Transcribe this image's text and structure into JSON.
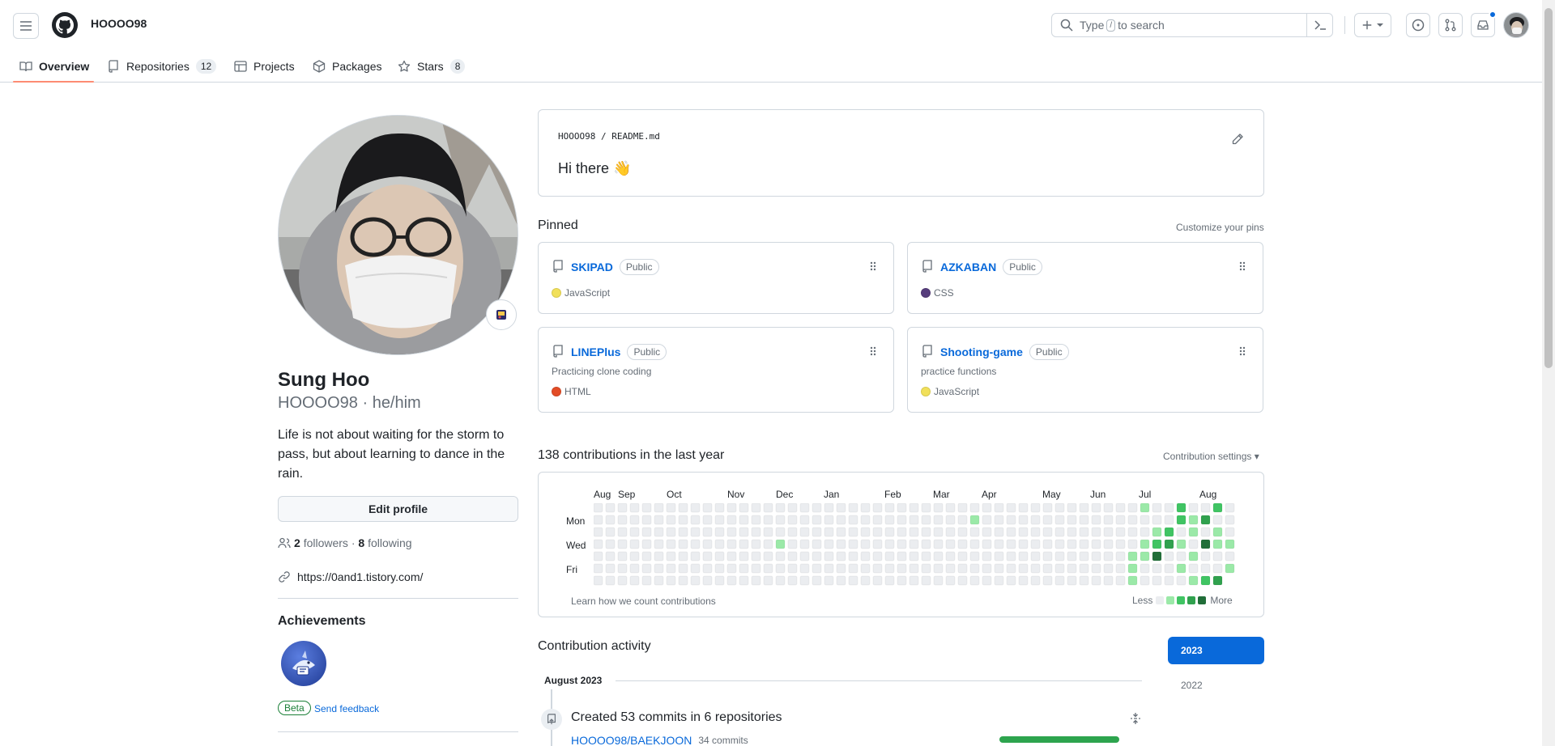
{
  "header": {
    "username": "HOOOO98",
    "search": {
      "prefix": "Type",
      "slash": "/",
      "suffix": "to search"
    },
    "has_notification": true
  },
  "tabs": [
    {
      "label": "Overview",
      "count": ""
    },
    {
      "label": "Repositories",
      "count": "12"
    },
    {
      "label": "Projects",
      "count": ""
    },
    {
      "label": "Packages",
      "count": ""
    },
    {
      "label": "Stars",
      "count": "8"
    }
  ],
  "profile": {
    "full_name": "Sung Hoo",
    "login_pronouns": "HOOOO98 · he/him",
    "bio": "Life is not about waiting for the storm to pass, but about learning to dance in the rain.",
    "edit_label": "Edit profile",
    "followers_count": "2",
    "followers_label": "followers",
    "sep": "·",
    "following_count": "8",
    "following_label": "following",
    "website": "https://0and1.tistory.com/",
    "achievements_title": "Achievements",
    "beta_label": "Beta",
    "feedback_label": "Send feedback"
  },
  "readme": {
    "path": "HOOOO98 / README.md",
    "heading": "Hi there 👋"
  },
  "pinned": {
    "title": "Pinned",
    "customize": "Customize your pins",
    "items": [
      {
        "name": "SKIPAD",
        "visibility": "Public",
        "description": "",
        "language": "JavaScript",
        "color": "#f1e05a"
      },
      {
        "name": "AZKABAN",
        "visibility": "Public",
        "description": "",
        "language": "CSS",
        "color": "#563d7c"
      },
      {
        "name": "LINEPlus",
        "visibility": "Public",
        "description": "Practicing clone coding",
        "language": "HTML",
        "color": "#e34c26"
      },
      {
        "name": "Shooting-game",
        "visibility": "Public",
        "description": "practice functions",
        "language": "JavaScript",
        "color": "#f1e05a"
      }
    ]
  },
  "contributions": {
    "title": "138 contributions in the last year",
    "settings": "Contribution settings ▾",
    "months": [
      "Aug",
      "Sep",
      "Oct",
      "Nov",
      "Dec",
      "Jan",
      "Feb",
      "Mar",
      "Apr",
      "May",
      "Jun",
      "Jul",
      "Aug"
    ],
    "days": [
      "Mon",
      "Wed",
      "Fri"
    ],
    "learn": "Learn how we count contributions",
    "less": "Less",
    "more": "More",
    "level_colors": [
      "#ebedf0",
      "#9be9a8",
      "#40c463",
      "#30a14e",
      "#216e39"
    ]
  },
  "chart_data": {
    "type": "heatmap",
    "title": "138 contributions in the last year",
    "x_labels": [
      "Aug",
      "Sep",
      "Oct",
      "Nov",
      "Dec",
      "Jan",
      "Feb",
      "Mar",
      "Apr",
      "May",
      "Jun",
      "Jul",
      "Aug"
    ],
    "y_labels": [
      "Mon",
      "Wed",
      "Fri"
    ],
    "weeks": 53,
    "active_cells": [
      {
        "week": 15,
        "day": 3,
        "level": 1
      },
      {
        "week": 31,
        "day": 1,
        "level": 1
      },
      {
        "week": 44,
        "day": 4,
        "level": 1
      },
      {
        "week": 44,
        "day": 5,
        "level": 1
      },
      {
        "week": 44,
        "day": 6,
        "level": 1
      },
      {
        "week": 45,
        "day": 3,
        "level": 1
      },
      {
        "week": 45,
        "day": 4,
        "level": 1
      },
      {
        "week": 45,
        "day": 0,
        "level": 1
      },
      {
        "week": 46,
        "day": 2,
        "level": 1
      },
      {
        "week": 46,
        "day": 3,
        "level": 2
      },
      {
        "week": 46,
        "day": 4,
        "level": 4
      },
      {
        "week": 47,
        "day": 2,
        "level": 2
      },
      {
        "week": 47,
        "day": 3,
        "level": 3
      },
      {
        "week": 48,
        "day": 0,
        "level": 2
      },
      {
        "week": 48,
        "day": 1,
        "level": 2
      },
      {
        "week": 48,
        "day": 3,
        "level": 1
      },
      {
        "week": 48,
        "day": 5,
        "level": 1
      },
      {
        "week": 49,
        "day": 1,
        "level": 1
      },
      {
        "week": 49,
        "day": 2,
        "level": 1
      },
      {
        "week": 49,
        "day": 4,
        "level": 1
      },
      {
        "week": 49,
        "day": 6,
        "level": 1
      },
      {
        "week": 50,
        "day": 1,
        "level": 3
      },
      {
        "week": 50,
        "day": 3,
        "level": 4
      },
      {
        "week": 50,
        "day": 6,
        "level": 2
      },
      {
        "week": 51,
        "day": 0,
        "level": 2
      },
      {
        "week": 51,
        "day": 2,
        "level": 1
      },
      {
        "week": 51,
        "day": 3,
        "level": 1
      },
      {
        "week": 51,
        "day": 6,
        "level": 3
      },
      {
        "week": 52,
        "day": 3,
        "level": 1
      },
      {
        "week": 52,
        "day": 5,
        "level": 1
      }
    ]
  },
  "activity": {
    "title": "Contribution activity",
    "years": [
      "2023",
      "2022"
    ],
    "month": "August 2023",
    "item": "Created 53 commits in 6 repositories",
    "repo": "HOOOO98/BAEKJOON",
    "repo_commits": "34 commits"
  }
}
